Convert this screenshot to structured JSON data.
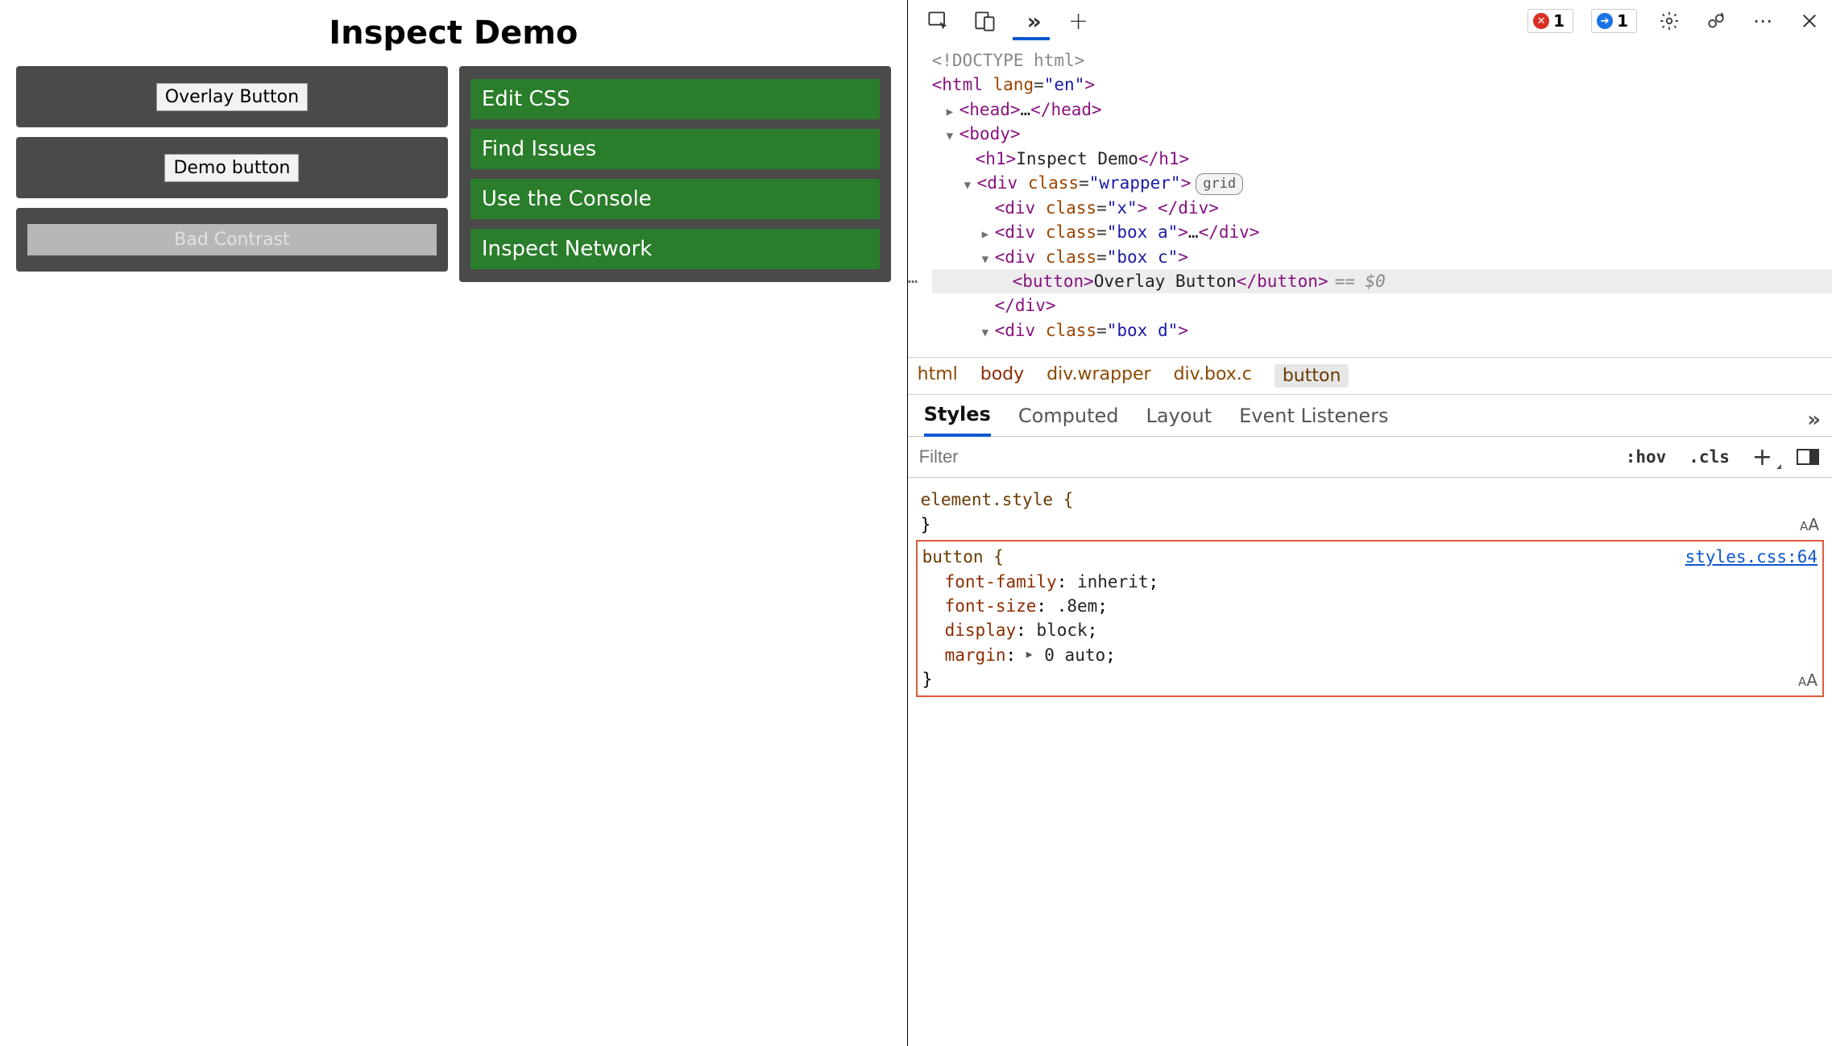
{
  "demo": {
    "title": "Inspect Demo",
    "overlay_button": "Overlay Button",
    "demo_button": "Demo button",
    "bad_contrast": "Bad Contrast",
    "links": [
      "Edit CSS",
      "Find Issues",
      "Use the Console",
      "Inspect Network"
    ]
  },
  "toolbar": {
    "errors_count": "1",
    "info_count": "1"
  },
  "dom": {
    "doctype": "<!DOCTYPE html>",
    "html_open": "html",
    "html_lang": "en",
    "head": "head",
    "body": "body",
    "h1_text": "Inspect Demo",
    "wrapper_class": "wrapper",
    "grid_pill": "grid",
    "x_class": "x",
    "box_a_class": "box a",
    "box_c_class": "box c",
    "button_text": "Overlay Button",
    "sel_suffix": "== $0",
    "box_d_class": "box d",
    "cutoff_hint": "Bad Contrast"
  },
  "breadcrumb": [
    "html",
    "body",
    "div.wrapper",
    "div.box.c",
    "button"
  ],
  "tabs": {
    "styles": "Styles",
    "computed": "Computed",
    "layout": "Layout",
    "event": "Event Listeners"
  },
  "filter": {
    "placeholder": "Filter",
    "hov": ":hov",
    "cls": ".cls"
  },
  "styles": {
    "element_style": "element.style {",
    "button_rule_sel": "button {",
    "source_link": "styles.css:64",
    "props": [
      {
        "n": "font-family",
        "v": "inherit"
      },
      {
        "n": "font-size",
        "v": ".8em"
      },
      {
        "n": "display",
        "v": "block"
      },
      {
        "n": "margin",
        "v": "0 auto",
        "expandable": true
      }
    ]
  }
}
